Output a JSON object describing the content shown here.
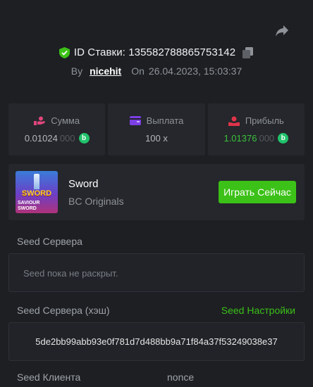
{
  "header": {
    "bet_id_label": "ID Ставки: 135582788865753142",
    "by_label": "By",
    "username": "nicehit",
    "on_label": "On",
    "date": "26.04.2023, 15:03:37"
  },
  "stats": [
    {
      "label": "Сумма",
      "value_main": "0.01024",
      "value_dim": "000",
      "icon": "hand-money-icon",
      "color": "#e0457b"
    },
    {
      "label": "Выплата",
      "value_main": "100 x",
      "value_dim": "",
      "icon": "wallet-icon",
      "color": "#7b3fe4"
    },
    {
      "label": "Прибыль",
      "value_main": "1.01376",
      "value_dim": "000",
      "icon": "profit-icon",
      "color": "#e0344a"
    }
  ],
  "coin_symbol": "b",
  "game": {
    "title": "Sword",
    "provider": "BC Originals",
    "play_label": "Играть Сейчас",
    "thumb_title": "SWORD",
    "thumb_subtitle": "SAVIOUR SWORD"
  },
  "server_seed": {
    "label": "Seed Сервера",
    "value": "Seed пока не раскрыт."
  },
  "server_seed_hash": {
    "label": "Seed Сервера (хэш)",
    "settings_label": "Seed Настройки",
    "value": "5de2bb99abb93e0f781d7d488bb9a71f84a37f53249038e37"
  },
  "client_seed": {
    "label": "Seed Клиента",
    "nonce_label": "nonce"
  },
  "colors": {
    "accent_green": "#3bc117",
    "background": "#1d1f23",
    "card": "#25272c",
    "coin": "#21c26b"
  }
}
